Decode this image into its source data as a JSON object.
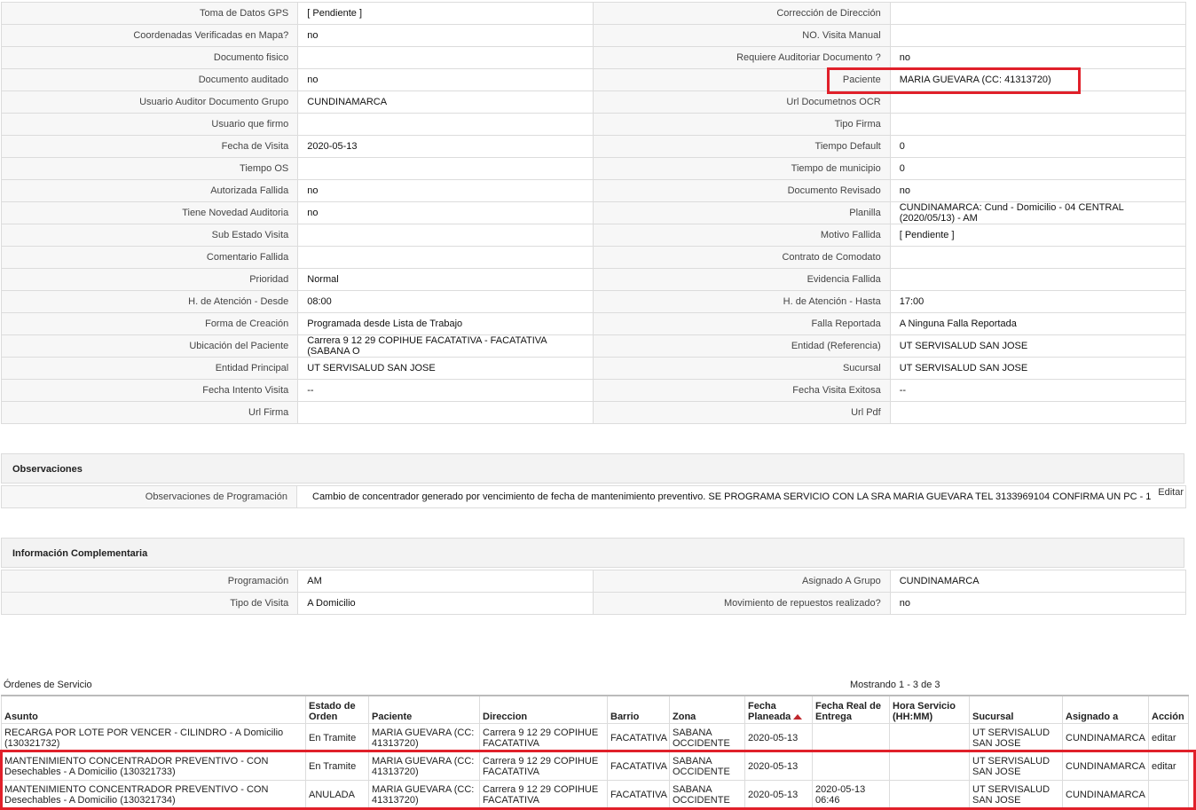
{
  "detail_rows": [
    {
      "l1": "Toma de Datos GPS",
      "v1": "[ Pendiente ]",
      "l2": "Corrección de Dirección",
      "v2": ""
    },
    {
      "l1": "Coordenadas Verificadas en Mapa?",
      "v1": "no",
      "l2": "NO. Visita Manual",
      "v2": ""
    },
    {
      "l1": "Documento fisico",
      "v1": "",
      "l2": "Requiere Auditoriar Documento ?",
      "v2": "no"
    },
    {
      "l1": "Documento auditado",
      "v1": "no",
      "l2": "Paciente",
      "v2": "MARIA GUEVARA (CC: 41313720)"
    },
    {
      "l1": "Usuario Auditor Documento Grupo",
      "v1": "CUNDINAMARCA",
      "l2": "Url Documetnos OCR",
      "v2": ""
    },
    {
      "l1": "Usuario que firmo",
      "v1": "",
      "l2": "Tipo Firma",
      "v2": ""
    },
    {
      "l1": "Fecha de Visita",
      "v1": "2020-05-13",
      "l2": "Tiempo Default",
      "v2": "0"
    },
    {
      "l1": "Tiempo OS",
      "v1": "",
      "l2": "Tiempo de municipio",
      "v2": "0"
    },
    {
      "l1": "Autorizada Fallida",
      "v1": "no",
      "l2": "Documento Revisado",
      "v2": "no"
    },
    {
      "l1": "Tiene Novedad Auditoria",
      "v1": "no",
      "l2": "Planilla",
      "v2": "CUNDINAMARCA: Cund - Domicilio - 04 CENTRAL (2020/05/13) - AM"
    },
    {
      "l1": "Sub Estado Visita",
      "v1": "",
      "l2": "Motivo Fallida",
      "v2": "[ Pendiente ]"
    },
    {
      "l1": "Comentario Fallida",
      "v1": "",
      "l2": "Contrato de Comodato",
      "v2": ""
    },
    {
      "l1": "Prioridad",
      "v1": "Normal",
      "l2": "Evidencia Fallida",
      "v2": ""
    },
    {
      "l1": "H. de Atención - Desde",
      "v1": "08:00",
      "l2": "H. de Atención - Hasta",
      "v2": "17:00"
    },
    {
      "l1": "Forma de Creación",
      "v1": "Programada desde Lista de Trabajo",
      "l2": "Falla Reportada",
      "v2": "A Ninguna Falla Reportada"
    },
    {
      "l1": "Ubicación del Paciente",
      "v1": "Carrera 9 12 29 COPIHUE FACATATIVA - FACATATIVA (SABANA O",
      "l2": "Entidad (Referencia)",
      "v2": "UT SERVISALUD SAN JOSE"
    },
    {
      "l1": "Entidad Principal",
      "v1": "UT SERVISALUD SAN JOSE",
      "l2": "Sucursal",
      "v2": "UT SERVISALUD SAN JOSE"
    },
    {
      "l1": "Fecha Intento Visita",
      "v1": "--",
      "l2": "Fecha Visita Exitosa",
      "v2": "--"
    },
    {
      "l1": "Url Firma",
      "v1": "",
      "l2": "Url Pdf",
      "v2": ""
    }
  ],
  "observaciones": {
    "title": "Observaciones",
    "label": "Observaciones de Programación",
    "value": "Cambio de concentrador generado por vencimiento de fecha de mantenimiento preventivo. SE PROGRAMA SERVICIO CON LA SRA MARIA GUEVARA TEL 3133969104 CONFIRMA UN PC - 1",
    "edit": "Editar"
  },
  "complementaria": {
    "title": "Información Complementaria",
    "rows": [
      {
        "l1": "Programación",
        "v1": "AM",
        "l2": "Asignado A Grupo",
        "v2": "CUNDINAMARCA"
      },
      {
        "l1": "Tipo de Visita",
        "v1": "A Domicilio",
        "l2": "Movimiento de repuestos realizado?",
        "v2": "no"
      }
    ]
  },
  "ordenes": {
    "title": "Órdenes de Servicio",
    "showing": "Mostrando 1 - 3 de 3",
    "headers": [
      "Asunto",
      "Estado de Orden",
      "Paciente",
      "Direccion",
      "Barrio",
      "Zona",
      "Fecha Planeada",
      "Fecha Real de Entrega",
      "Hora Servicio (HH:MM)",
      "Sucursal",
      "Asignado a",
      "Acción"
    ],
    "rows": [
      [
        "RECARGA POR LOTE POR VENCER - CILINDRO - A Domicilio (130321732)",
        "En Tramite",
        "MARIA GUEVARA (CC: 41313720)",
        "Carrera 9 12 29 COPIHUE FACATATIVA",
        "FACATATIVA",
        "SABANA OCCIDENTE",
        "2020-05-13",
        "",
        "",
        "UT SERVISALUD SAN JOSE",
        "CUNDINAMARCA",
        "editar"
      ],
      [
        "MANTENIMIENTO CONCENTRADOR PREVENTIVO - CON Desechables - A Domicilio (130321733)",
        "En Tramite",
        "MARIA GUEVARA (CC: 41313720)",
        "Carrera 9 12 29 COPIHUE FACATATIVA",
        "FACATATIVA",
        "SABANA OCCIDENTE",
        "2020-05-13",
        "",
        "",
        "UT SERVISALUD SAN JOSE",
        "CUNDINAMARCA",
        "editar"
      ],
      [
        "MANTENIMIENTO CONCENTRADOR PREVENTIVO - CON Desechables - A Domicilio (130321734)",
        "ANULADA",
        "MARIA GUEVARA (CC: 41313720)",
        "Carrera 9 12 29 COPIHUE FACATATIVA",
        "FACATATIVA",
        "SABANA OCCIDENTE",
        "2020-05-13",
        "2020-05-13 06:46",
        "",
        "UT SERVISALUD SAN JOSE",
        "CUNDINAMARCA",
        ""
      ]
    ]
  },
  "colors": {
    "highlight": "#e0202a",
    "sort_arrow": "#c0272d"
  }
}
